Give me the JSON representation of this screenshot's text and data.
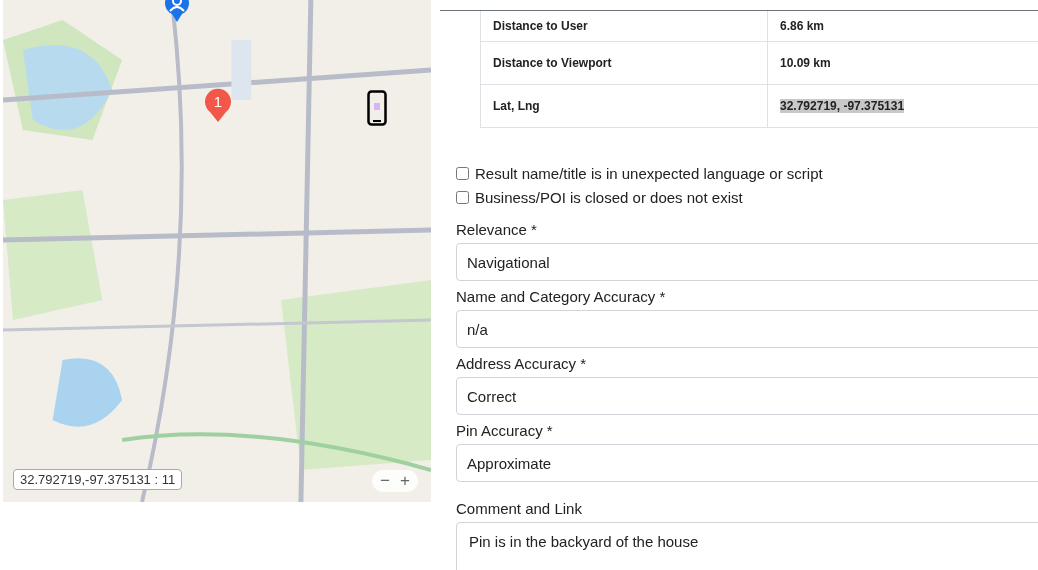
{
  "map": {
    "kind": "picture",
    "marker": {
      "label": "1"
    },
    "coordinates": "32.792719,-97.375131 : 11",
    "zoom_out": "−",
    "zoom_in": "+"
  },
  "details": {
    "rows": [
      {
        "label": "Distance to User",
        "value": "6.86 km",
        "highlighted": false
      },
      {
        "label": "Distance to Viewport",
        "value": "10.09 km",
        "highlighted": false
      },
      {
        "label": "Lat, Lng",
        "value": "32.792719, -97.375131",
        "highlighted": true
      }
    ]
  },
  "flags": [
    {
      "label": "Result name/title is in unexpected language or script",
      "checked": false
    },
    {
      "label": "Business/POI is closed or does not exist",
      "checked": false
    }
  ],
  "fields": [
    {
      "label": "Relevance *",
      "value": "Navigational"
    },
    {
      "label": "Name and Category Accuracy *",
      "value": "n/a"
    },
    {
      "label": "Address Accuracy *",
      "value": "Correct"
    },
    {
      "label": "Pin Accuracy *",
      "value": "Approximate"
    }
  ],
  "comment": {
    "label": "Comment and Link",
    "value": "Pin is in the backyard of the house"
  }
}
